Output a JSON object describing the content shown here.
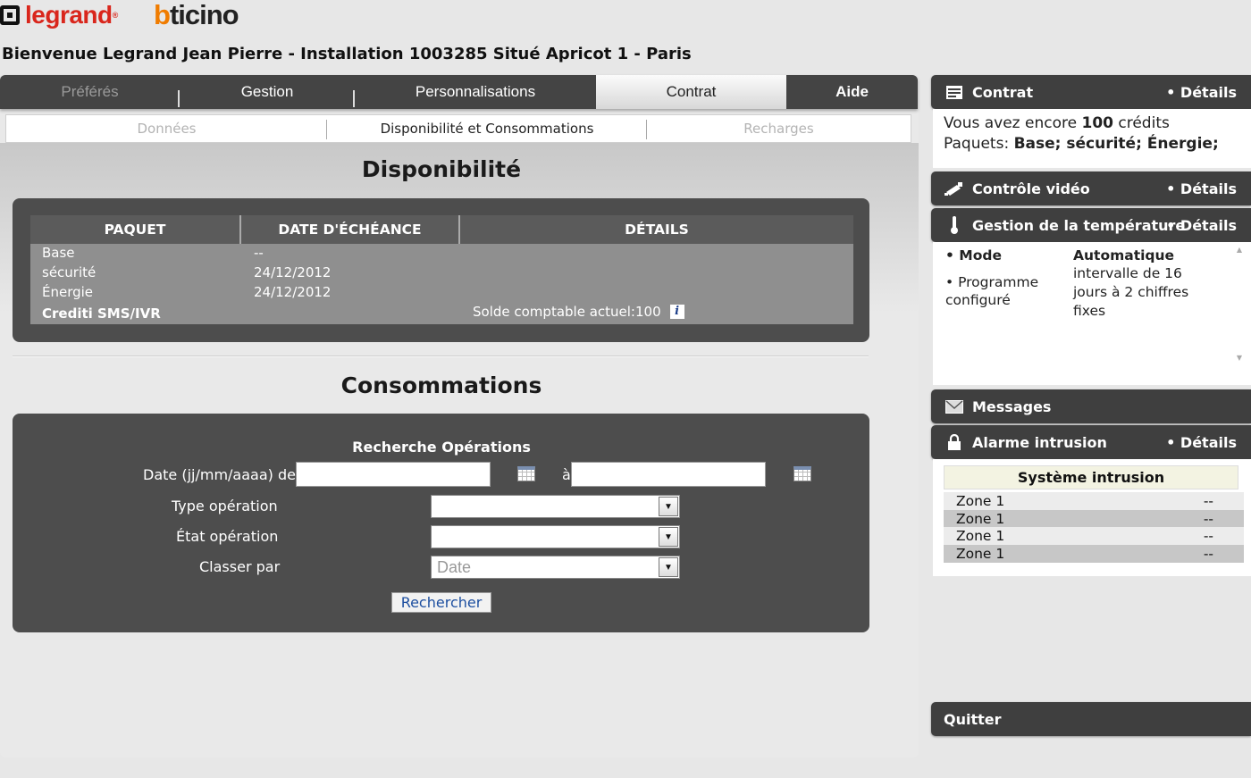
{
  "header": {
    "logo_legrand": "legrand",
    "logo_bticino": "bticino",
    "welcome": "Bienvenue Legrand Jean Pierre - Installation 1003285 Situé Apricot 1 - Paris"
  },
  "tabs": [
    {
      "label": "Préférés"
    },
    {
      "label": "Gestion"
    },
    {
      "label": "Personnalisations"
    },
    {
      "label": "Contrat"
    },
    {
      "label": "Aide"
    }
  ],
  "subtabs": [
    {
      "label": "Données"
    },
    {
      "label": "Disponibilité et Consommations"
    },
    {
      "label": "Recharges"
    }
  ],
  "dispo": {
    "title": "Disponibilité",
    "columns": [
      "PAQUET",
      "DATE D'ÉCHÉANCE",
      "DÉTAILS"
    ],
    "rows": [
      {
        "paquet": "Base",
        "date": "--"
      },
      {
        "paquet": "sécurité",
        "date": "24/12/2012"
      },
      {
        "paquet": "Énergie",
        "date": "24/12/2012"
      }
    ],
    "credit_label": "Crediti SMS/IVR",
    "credit_detail": "Solde comptable actuel:100",
    "info_glyph": "i"
  },
  "conso": {
    "title": "Consommations",
    "search_title": "Recherche Opérations",
    "date_label": "Date (jj/mm/aaaa) de",
    "date_to": "à",
    "date_from_value": "",
    "date_to_value": "",
    "type_label": "Type opération",
    "type_value": "",
    "etat_label": "État opération",
    "etat_value": "",
    "sort_label": "Classer par",
    "sort_value": "Date",
    "search_button": "Rechercher"
  },
  "right": {
    "contrat": {
      "title": "Contrat",
      "details": "• Détails",
      "line1_prefix": "Vous avez encore ",
      "line1_count": "100",
      "line1_suffix": " crédits",
      "line2_prefix": "Paquets: ",
      "line2_value": "Base; sécurité; Énergie;"
    },
    "video": {
      "title": "Contrôle vidéo",
      "details": "•  Détails"
    },
    "temperature": {
      "title": "Gestion de la température",
      "details": "• Détails",
      "mode_label": "• Mode",
      "mode_value": "Automatique",
      "prog_label_1": "• Programme",
      "prog_label_2": "configuré",
      "prog_value_1": "intervalle de 16",
      "prog_value_2": "jours à 2 chiffres",
      "prog_value_3": "fixes"
    },
    "messages": {
      "title": "Messages"
    },
    "alarme": {
      "title": "Alarme intrusion",
      "details": "• Détails",
      "system_title": "Système intrusion",
      "zones": [
        {
          "name": "Zone 1",
          "status": "--"
        },
        {
          "name": "Zone 1",
          "status": "--"
        },
        {
          "name": "Zone 1",
          "status": "--"
        },
        {
          "name": "Zone 1",
          "status": "--"
        }
      ]
    },
    "quit": "Quitter"
  },
  "colors": {
    "brand_red": "#d9261c",
    "brand_orange": "#f07c00",
    "dark_panel": "#4d4d4d",
    "link_blue": "#1d4fa0"
  }
}
